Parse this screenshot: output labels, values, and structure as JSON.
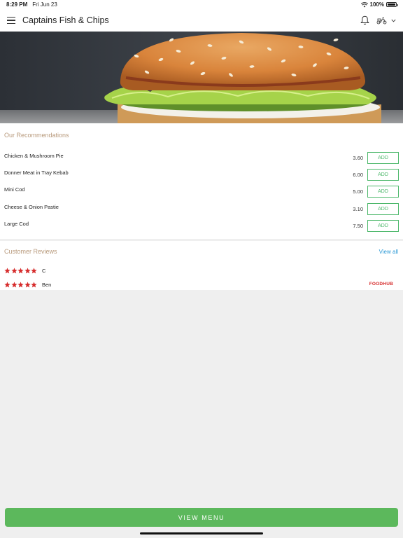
{
  "status_bar": {
    "time": "8:29 PM",
    "date": "Fri Jun 23",
    "battery": "100%",
    "battery_level": 1.0
  },
  "header": {
    "title": "Captains Fish & Chips",
    "icons": [
      "menu-icon",
      "bell-icon",
      "scooter-icon",
      "chevron-down-icon"
    ]
  },
  "recommendations": {
    "title": "Our Recommendations",
    "items": [
      {
        "name": "Chicken & Mushroom Pie",
        "price": "3.60",
        "button": "ADD"
      },
      {
        "name": "Donner Meat in Tray Kebab",
        "price": "6.00",
        "button": "ADD"
      },
      {
        "name": "Mini Cod",
        "price": "5.00",
        "button": "ADD"
      },
      {
        "name": "Cheese & Onion Pastie",
        "price": "3.10",
        "button": "ADD"
      },
      {
        "name": "Large Cod",
        "price": "7.50",
        "button": "ADD"
      }
    ]
  },
  "reviews": {
    "title": "Customer Reviews",
    "view_all": "View all",
    "items": [
      {
        "name": "C",
        "rating": 5
      },
      {
        "name": "Ben",
        "rating": 5
      }
    ],
    "brand": "FOODHUB"
  },
  "footer": {
    "view_menu": "VIEW MENU"
  },
  "colors": {
    "accent_green": "#5cb85c",
    "section_title": "#b89a7c",
    "link_blue": "#2e9ad6",
    "star_red": "#d62b2b"
  }
}
